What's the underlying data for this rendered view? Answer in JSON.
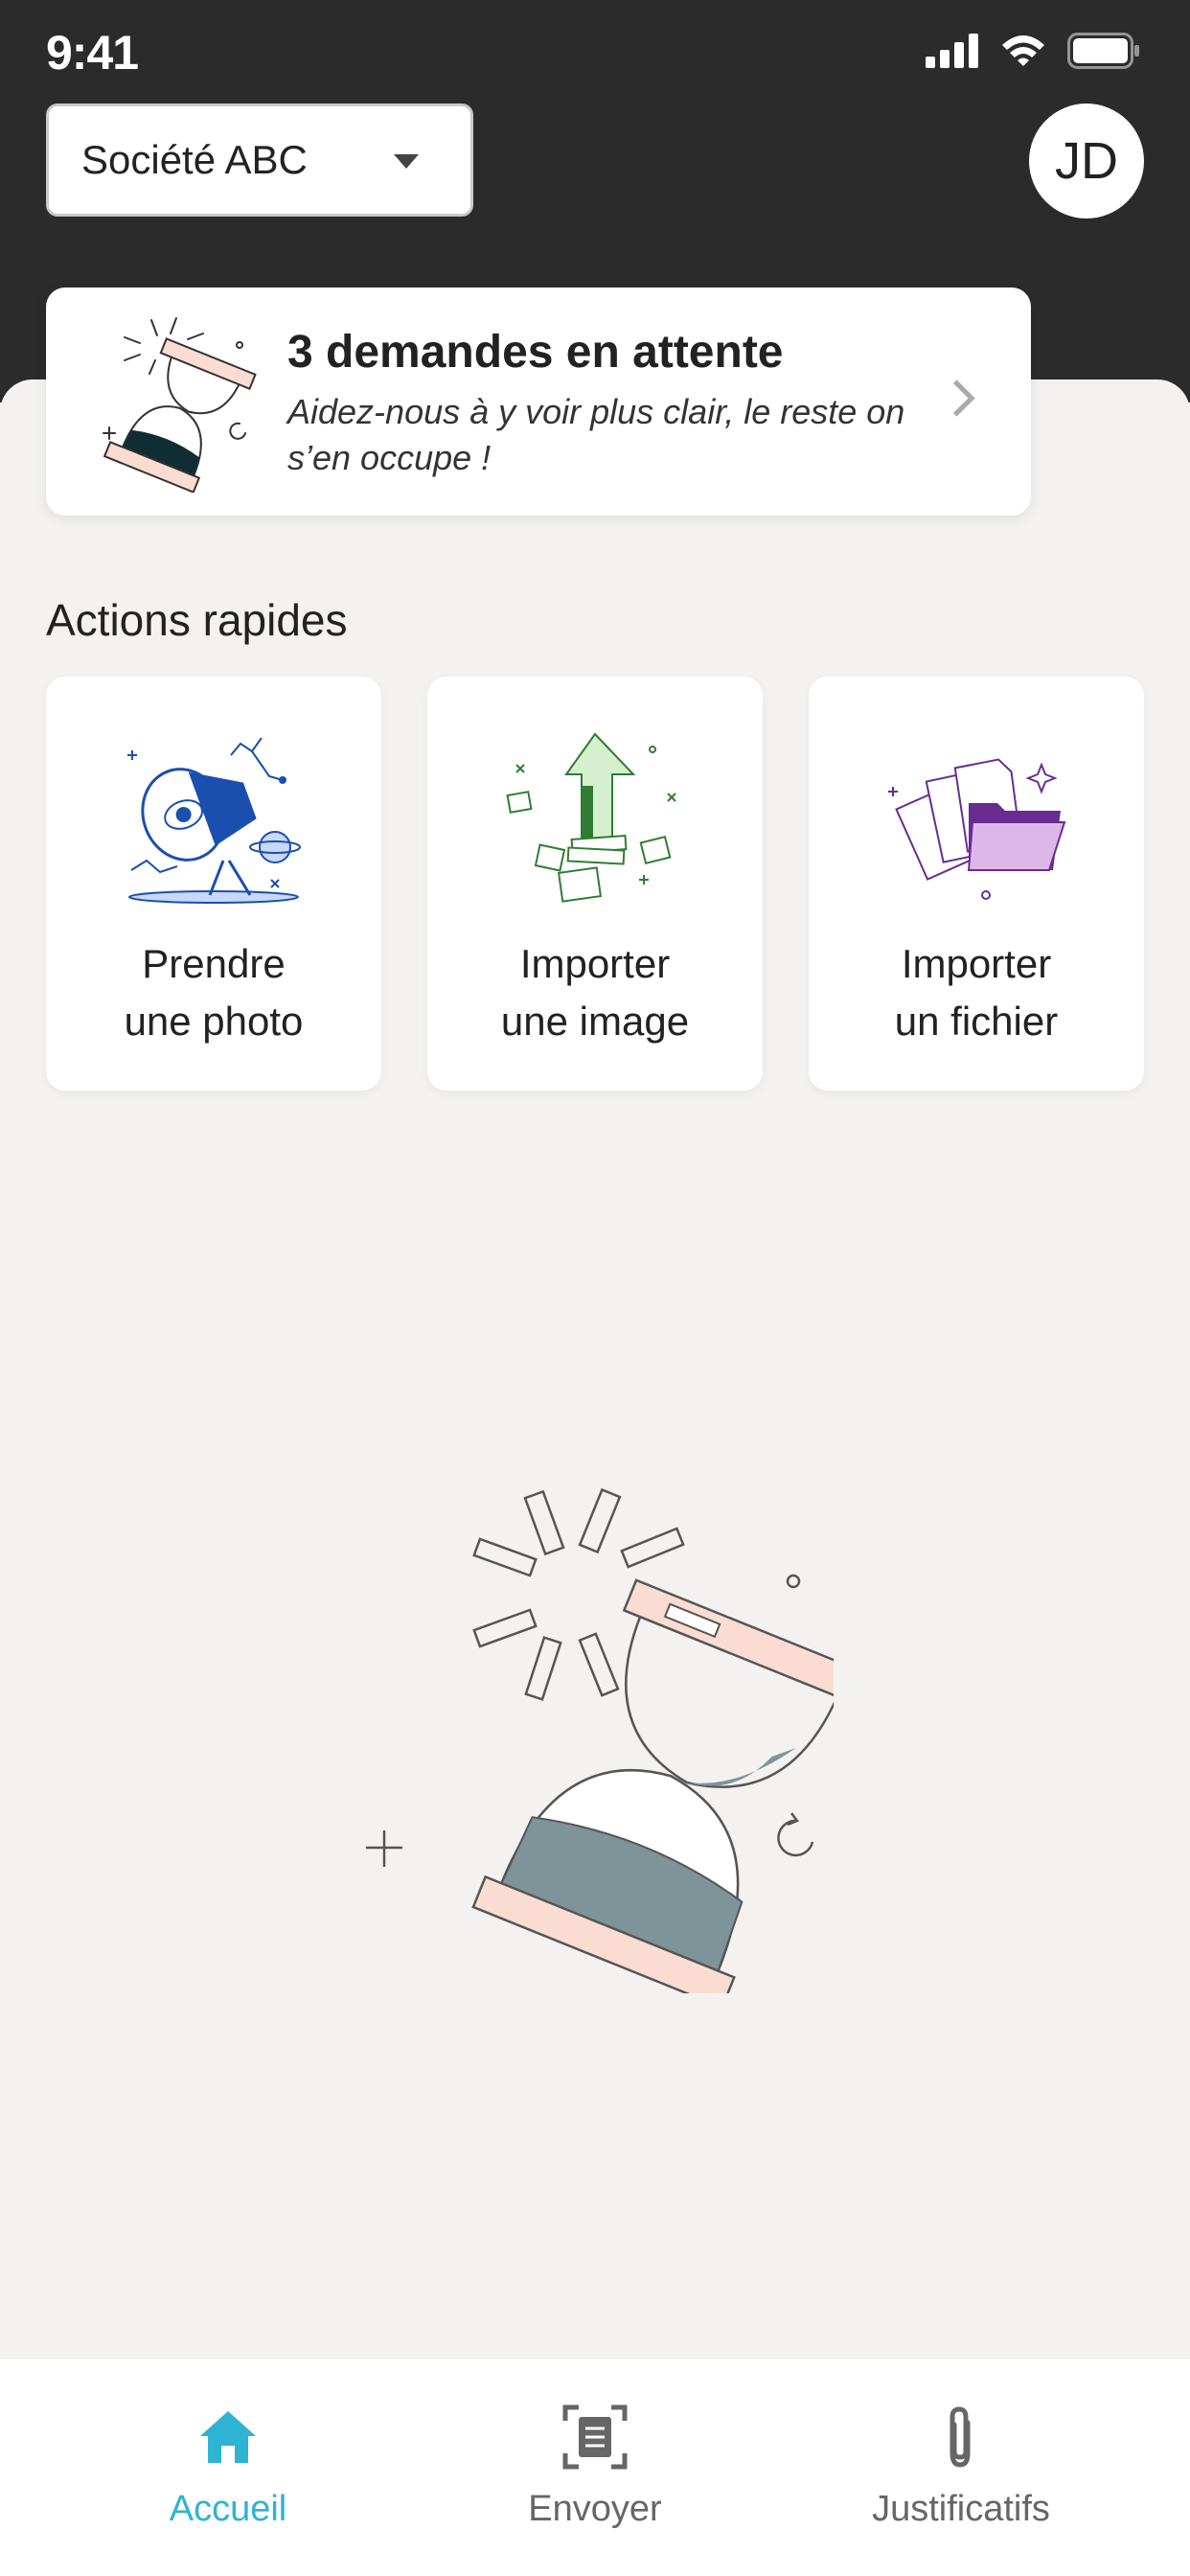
{
  "status_bar": {
    "time": "9:41"
  },
  "header": {
    "company_name": "Société ABC",
    "avatar_initials": "JD"
  },
  "pending": {
    "title": "3 demandes en attente",
    "subtitle": "Aidez-nous à y voir plus clair, le reste on s’en occupe !"
  },
  "quick_actions": {
    "title": "Actions rapides",
    "items": [
      {
        "line1": "Prendre",
        "line2": "une photo",
        "icon": "telescope-icon"
      },
      {
        "line1": "Importer",
        "line2": "une image",
        "icon": "upload-arrow-icon"
      },
      {
        "line1": "Importer",
        "line2": "un fichier",
        "icon": "folder-icon"
      }
    ]
  },
  "nav": {
    "items": [
      {
        "label": "Accueil",
        "icon": "home-icon",
        "active": true
      },
      {
        "label": "Envoyer",
        "icon": "scan-document-icon",
        "active": false
      },
      {
        "label": "Justificatifs",
        "icon": "paperclip-icon",
        "active": false
      }
    ]
  },
  "colors": {
    "header_bg": "#2b2b2b",
    "page_bg": "#f3f2f1",
    "accent": "#2fb3d2",
    "hourglass_sand": "#7e9498",
    "hourglass_caps": "#fbdcd3"
  }
}
